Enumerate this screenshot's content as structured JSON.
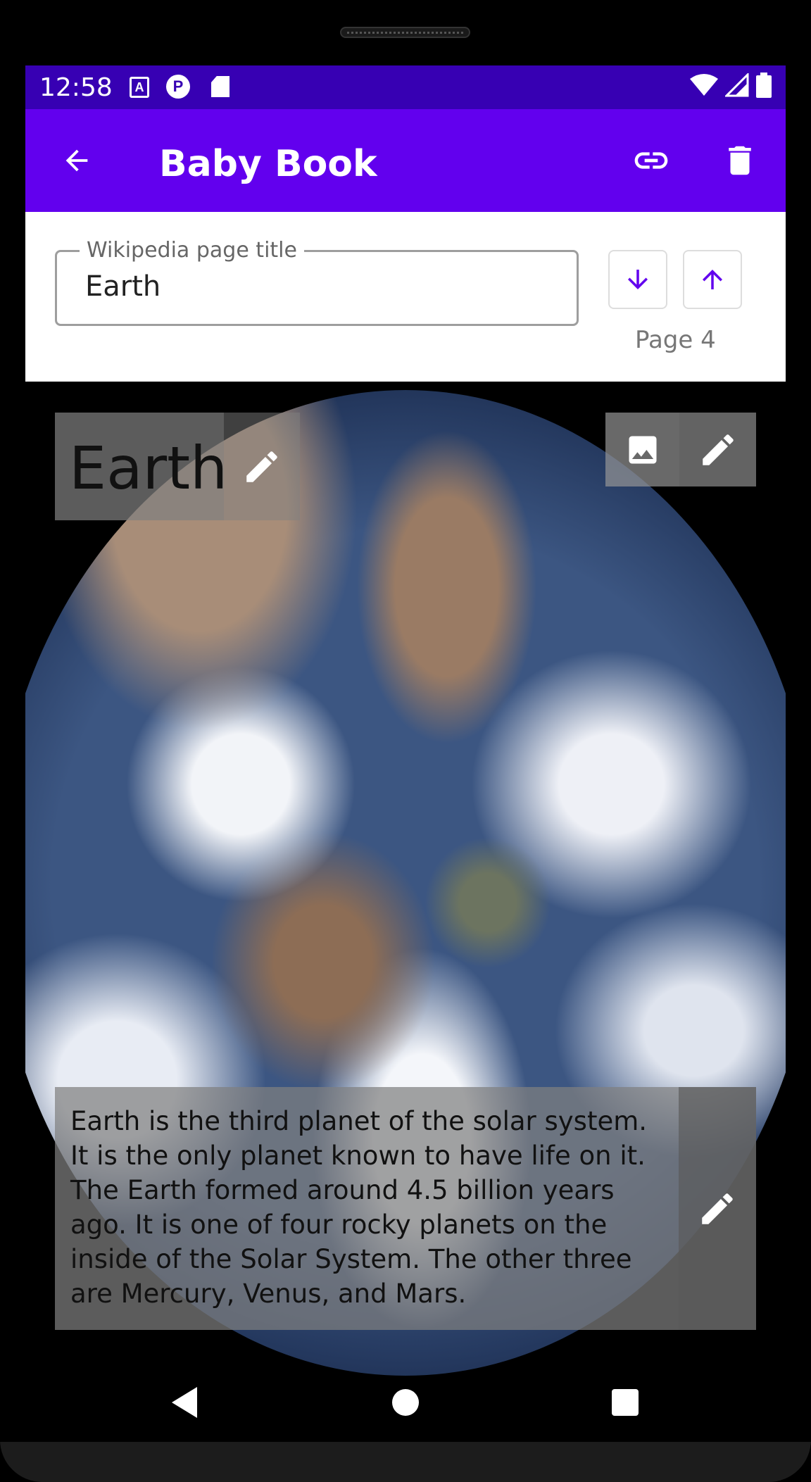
{
  "status_bar": {
    "time": "12:58",
    "left_icons": [
      "accessibility-icon",
      "notification-p-icon",
      "sd-card-icon"
    ],
    "right_icons": [
      "wifi-icon",
      "signal-icon",
      "battery-icon"
    ]
  },
  "app_bar": {
    "title": "Baby Book",
    "back_icon": "arrow-back-icon",
    "link_icon": "link-icon",
    "delete_icon": "delete-icon"
  },
  "page_editor": {
    "field_label": "Wikipedia page title",
    "field_value": "Earth",
    "move_down_icon": "arrow-down-icon",
    "move_up_icon": "arrow-up-icon",
    "page_label": "Page 4"
  },
  "page_content": {
    "title": "Earth",
    "description": "Earth is the third planet of the solar system. It is the only planet known to have life on it. The Earth formed around 4.5 billion years ago. It is one of four rocky planets on the inside of the Solar System. The other three are Mercury, Venus, and Mars.",
    "image_icon": "image-icon",
    "edit_icon": "edit-pencil-icon"
  },
  "nav_bar": {
    "items": [
      "back-nav-icon",
      "home-nav-icon",
      "recents-nav-icon"
    ]
  },
  "colors": {
    "status_bar": "#3700b3",
    "app_bar": "#6200ee",
    "accent": "#6200ee"
  }
}
